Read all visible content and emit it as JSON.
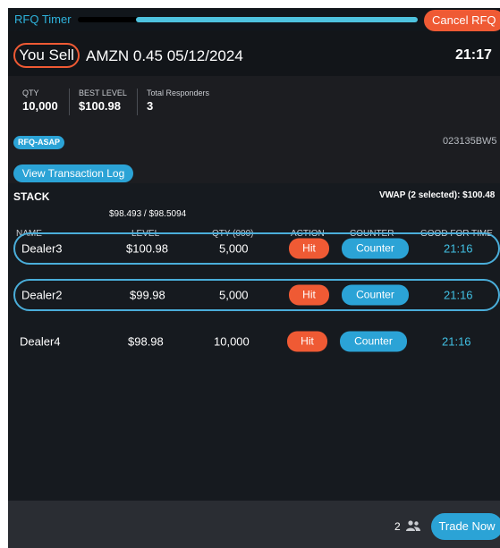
{
  "timer": {
    "label": "RFQ Timer",
    "remaining_fraction": 0.83,
    "cancel_label": "Cancel RFQ"
  },
  "header": {
    "side": "You Sell",
    "instrument": "AMZN 0.45 05/12/2024",
    "time": "21:17"
  },
  "stats": [
    {
      "label": "QTY",
      "value": "10,000"
    },
    {
      "label": "BEST LEVEL",
      "value": "$100.98"
    },
    {
      "label": "Total Responders",
      "value": "3"
    }
  ],
  "tag": "RFQ-ASAP",
  "reference": "023135BW5",
  "log_button": "View Transaction Log",
  "stack": {
    "title": "STACK",
    "vwap": "VWAP (2 selected): $100.48",
    "bid_ask": "$98.493 / $98.5094",
    "columns": {
      "name": "NAME",
      "level": "LEVEL",
      "qty": "QTY (000)",
      "action": "ACTION",
      "counter": "COUNTER",
      "gft": "GOOD FOR TIME"
    },
    "rows": [
      {
        "name": "Dealer3",
        "level": "$100.98",
        "qty": "5,000",
        "action": "Hit",
        "counter": "Counter",
        "gft": "21:16",
        "selected": true
      },
      {
        "name": "Dealer2",
        "level": "$99.98",
        "qty": "5,000",
        "action": "Hit",
        "counter": "Counter",
        "gft": "21:16",
        "selected": true
      },
      {
        "name": "Dealer4",
        "level": "$98.98",
        "qty": "10,000",
        "action": "Hit",
        "counter": "Counter",
        "gft": "21:16",
        "selected": false
      }
    ]
  },
  "footer": {
    "responders": "2",
    "icon": "people-icon",
    "trade_button": "Trade Now"
  },
  "colors": {
    "accent": "#2ba3d6",
    "sell": "#ef5a34",
    "background": "#1c1d21"
  }
}
